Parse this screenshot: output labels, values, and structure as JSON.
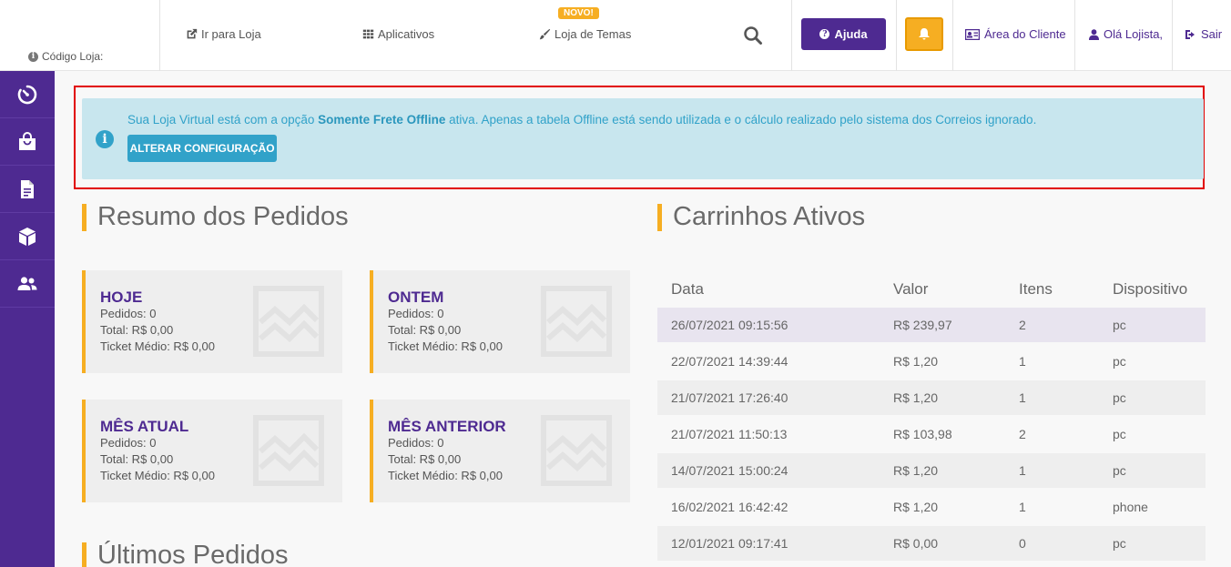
{
  "header": {
    "store_code_label": "Código Loja:",
    "nav": {
      "store_link": "Ir para Loja",
      "apps_link": "Aplicativos",
      "themes_link": "Loja de Temas",
      "themes_badge": "NOVO!"
    },
    "help_label": "Ajuda",
    "client_area": "Área do Cliente",
    "greeting": "Olá Lojista,",
    "logout": "Sair"
  },
  "sidebar": {
    "items": [
      {
        "icon": "dashboard-timer-icon"
      },
      {
        "icon": "shopping-bag-icon"
      },
      {
        "icon": "document-icon"
      },
      {
        "icon": "box-icon"
      },
      {
        "icon": "users-icon"
      }
    ]
  },
  "alert": {
    "text_before": "Sua Loja Virtual está com a opção ",
    "text_bold": "Somente Frete Offline",
    "text_after": " ativa. Apenas a tabela Offline está sendo utilizada e o cálculo realizado pelo sistema dos Correios ignorado.",
    "button_label": "ALTERAR CONFIGURAÇÃO"
  },
  "orders_summary": {
    "title": "Resumo dos Pedidos",
    "cards": [
      {
        "title": "HOJE",
        "orders": "Pedidos: 0",
        "total": "Total: R$ 0,00",
        "ticket": "Ticket Médio: R$ 0,00"
      },
      {
        "title": "ONTEM",
        "orders": "Pedidos: 0",
        "total": "Total: R$ 0,00",
        "ticket": "Ticket Médio: R$ 0,00"
      },
      {
        "title": "MÊS ATUAL",
        "orders": "Pedidos: 0",
        "total": "Total: R$ 0,00",
        "ticket": "Ticket Médio: R$ 0,00"
      },
      {
        "title": "MÊS ANTERIOR",
        "orders": "Pedidos: 0",
        "total": "Total: R$ 0,00",
        "ticket": "Ticket Médio: R$ 0,00"
      }
    ]
  },
  "last_orders": {
    "title": "Últimos Pedidos"
  },
  "active_carts": {
    "title": "Carrinhos Ativos",
    "columns": [
      "Data",
      "Valor",
      "Itens",
      "Dispositivo"
    ],
    "rows": [
      [
        "26/07/2021 09:15:56",
        "R$ 239,97",
        "2",
        "pc"
      ],
      [
        "22/07/2021 14:39:44",
        "R$ 1,20",
        "1",
        "pc"
      ],
      [
        "21/07/2021 17:26:40",
        "R$ 1,20",
        "1",
        "pc"
      ],
      [
        "21/07/2021 11:50:13",
        "R$ 103,98",
        "2",
        "pc"
      ],
      [
        "14/07/2021 15:00:24",
        "R$ 1,20",
        "1",
        "pc"
      ],
      [
        "16/02/2021 16:42:42",
        "R$ 1,20",
        "1",
        "phone"
      ],
      [
        "12/01/2021 09:17:41",
        "R$ 0,00",
        "0",
        "pc"
      ]
    ]
  },
  "colors": {
    "brand_purple": "#4e2a91",
    "accent_yellow": "#f6ae22",
    "info_blue": "#31a2c9",
    "alert_bg": "#c8e6ee",
    "highlight_border": "#e10000"
  }
}
